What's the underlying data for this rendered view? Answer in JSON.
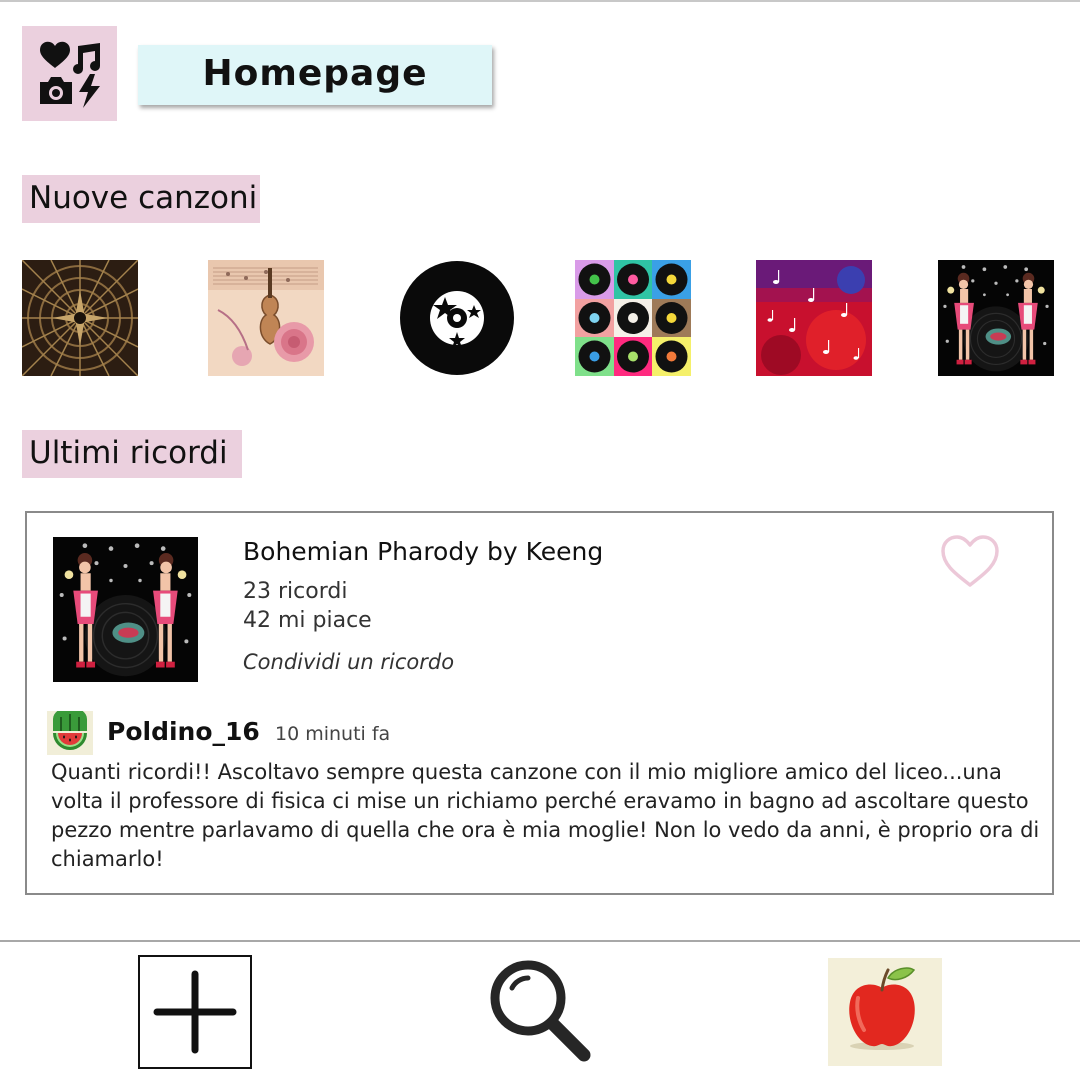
{
  "header": {
    "title": "Homepage",
    "logo_icon": "heart-music-camera-bolt-icon"
  },
  "sections": {
    "new_songs": "Nuove canzoni",
    "latest_memories": "Ultimi ricordi"
  },
  "new_songs": [
    {
      "cover": "mandala-pattern"
    },
    {
      "cover": "vintage-violin-roses"
    },
    {
      "cover": "vinyl-stars"
    },
    {
      "cover": "vinyl-grid-pop-art"
    },
    {
      "cover": "red-music-notes"
    },
    {
      "cover": "pinup-vinyl"
    }
  ],
  "memory_card": {
    "song_title": "Bohemian Pharody by Keeng",
    "memories_count": "23 ricordi",
    "likes_count": "42 mi piace",
    "share_link": "Condividi un ricordo",
    "like_icon": "heart-outline-icon",
    "post": {
      "username": "Poldino_16",
      "time": "10 minuti fa",
      "avatar": "watermelon",
      "text": "Quanti ricordi!! Ascoltavo sempre questa canzone con il mio migliore amico del liceo...una volta il professore di fisica ci mise un richiamo perché eravamo in bagno ad ascoltare questo pezzo mentre parlavamo di quella che ora è mia moglie! Non lo vedo da anni, è proprio ora di chiamarlo!"
    }
  },
  "bottom_nav": {
    "add_icon": "plus-icon",
    "search_icon": "search-icon",
    "profile_avatar": "apple"
  },
  "colors": {
    "pink_accent": "#ebd0de",
    "title_bg": "#dff6f8",
    "heart_outline": "#ecc8d8"
  }
}
